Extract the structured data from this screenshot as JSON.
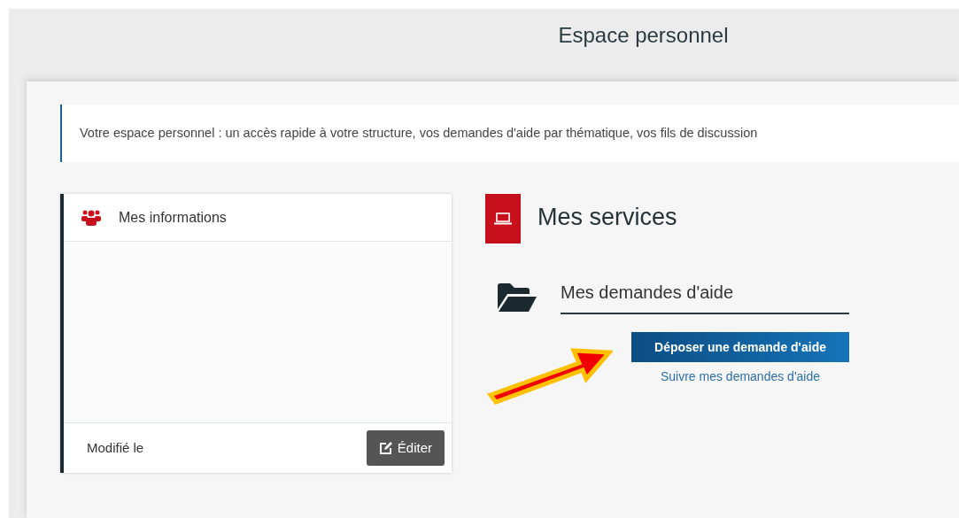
{
  "page_title": "Espace personnel",
  "intro": "Votre espace personnel : un accès rapide à votre structure, vos demandes d'aide par thématique, vos fils de discussion",
  "info_card": {
    "title": "Mes informations",
    "modified_label": "Modifié le",
    "edit_button": "Éditer"
  },
  "services": {
    "title": "Mes services",
    "sections": [
      {
        "title": "Mes demandes d'aide",
        "links": [
          {
            "label": "Déposer une demande d'aide",
            "kind": "primary"
          },
          {
            "label": "Suivre mes demandes d'aide",
            "kind": "link"
          }
        ]
      }
    ]
  }
}
